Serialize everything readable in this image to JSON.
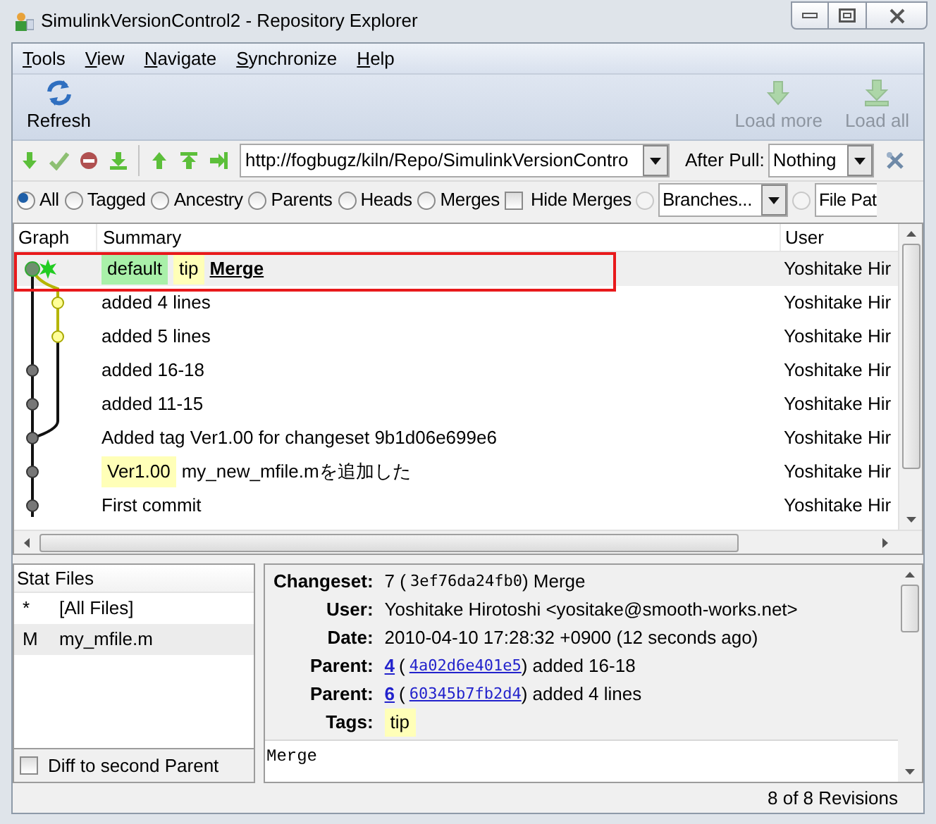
{
  "window": {
    "title": "SimulinkVersionControl2 - Repository Explorer"
  },
  "menu": [
    "Tools",
    "View",
    "Navigate",
    "Synchronize",
    "Help"
  ],
  "toolbar": [
    {
      "kind": "refresh",
      "label": "Refresh",
      "disabled": false
    },
    {
      "kind": "load_more",
      "label": "Load more",
      "disabled": true
    },
    {
      "kind": "load_all",
      "label": "Load all",
      "disabled": true
    }
  ],
  "pull_bar": {
    "url": "http://fogbugz/kiln/Repo/SimulinkVersionContro",
    "after_pull_label": "After Pull:",
    "after_pull_value": "Nothing"
  },
  "filters": [
    {
      "label": "All",
      "selected": true
    },
    {
      "label": "Tagged",
      "selected": false
    },
    {
      "label": "Ancestry",
      "selected": false
    },
    {
      "label": "Parents",
      "selected": false
    },
    {
      "label": "Heads",
      "selected": false
    },
    {
      "label": "Merges",
      "selected": false
    }
  ],
  "hide_merges": {
    "label": "Hide Merges",
    "checked": false
  },
  "branches": {
    "value": "Branches...",
    "selected": false
  },
  "file_pattern": {
    "value": "File Pat",
    "selected": false
  },
  "graph_table": {
    "columns": [
      "Graph",
      "Summary",
      "User"
    ],
    "rows": [
      {
        "tags": [
          {
            "text": "default",
            "color": "#a9f0a9"
          },
          {
            "text": "tip",
            "color": "#ffffb8"
          }
        ],
        "summary": "Merge",
        "user": "Yoshitake Hir",
        "selected": true,
        "current": true,
        "highlighted": true
      },
      {
        "summary": "added 4 lines",
        "user": "Yoshitake Hir",
        "selected": false,
        "current": false,
        "highlighted": false
      },
      {
        "summary": "added 5 lines",
        "user": "Yoshitake Hir",
        "selected": false,
        "current": false,
        "highlighted": false
      },
      {
        "summary": "added 16-18",
        "user": "Yoshitake Hir",
        "selected": false,
        "current": false,
        "highlighted": false
      },
      {
        "summary": "added 11-15",
        "user": "Yoshitake Hir",
        "selected": false,
        "current": false,
        "highlighted": false
      },
      {
        "summary": "Added tag Ver1.00 for changeset 9b1d06e699e6",
        "user": "Yoshitake Hir",
        "selected": false,
        "current": false,
        "highlighted": false
      },
      {
        "tags": [
          {
            "text": "Ver1.00",
            "color": "#ffffb8"
          }
        ],
        "summary": "my_new_mfile.mを追加した",
        "user": "Yoshitake Hir",
        "selected": false,
        "current": false,
        "highlighted": false
      },
      {
        "summary": "First commit",
        "user": "Yoshitake Hir",
        "selected": false,
        "current": false,
        "highlighted": false
      }
    ]
  },
  "stat_files": {
    "columns": [
      "Stat",
      "Files"
    ],
    "rows": [
      {
        "stat": "*",
        "file": "[All Files]",
        "selected": false
      },
      {
        "stat": "M",
        "file": "my_mfile.m",
        "selected": true
      }
    ],
    "diff_to_second_parent": {
      "label": "Diff to second Parent",
      "checked": false
    }
  },
  "details": {
    "fields": [
      {
        "label": "Changeset:",
        "parts": [
          {
            "kind": "text",
            "text": "7 ("
          },
          {
            "kind": "mono",
            "text": "3ef76da24fb0"
          },
          {
            "kind": "text",
            "text": ") Merge"
          }
        ]
      },
      {
        "label": "User:",
        "parts": [
          {
            "kind": "text",
            "text": "Yoshitake Hirotoshi <yositake@smooth-works.net>"
          }
        ]
      },
      {
        "label": "Date:",
        "parts": [
          {
            "kind": "text",
            "text": "2010-04-10 17:28:32 +0900 (12 seconds ago)"
          }
        ]
      },
      {
        "label": "Parent:",
        "parts": [
          {
            "kind": "link",
            "text": "4"
          },
          {
            "kind": "text",
            "text": "("
          },
          {
            "kind": "link_mono",
            "text": "4a02d6e401e5"
          },
          {
            "kind": "text",
            "text": ") added 16-18"
          }
        ]
      },
      {
        "label": "Parent:",
        "parts": [
          {
            "kind": "link",
            "text": "6"
          },
          {
            "kind": "text",
            "text": "("
          },
          {
            "kind": "link_mono",
            "text": "60345b7fb2d4"
          },
          {
            "kind": "text",
            "text": ") added 4 lines"
          }
        ]
      },
      {
        "label": "Tags:",
        "parts": [
          {
            "kind": "tag",
            "text": "tip"
          }
        ]
      }
    ],
    "description": "Merge"
  },
  "status_bar": "8 of 8 Revisions"
}
